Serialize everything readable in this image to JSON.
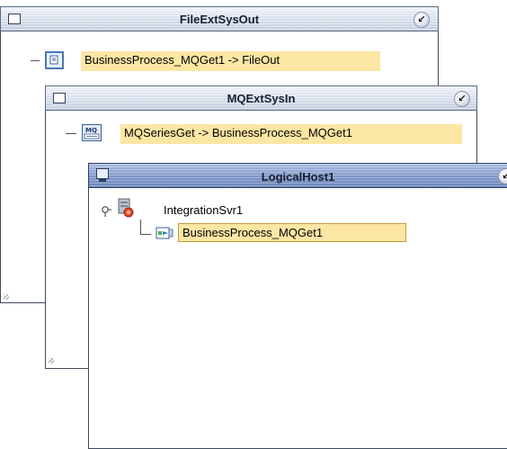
{
  "windows": [
    {
      "title": "FileExtSysOut",
      "rows": [
        {
          "label": "BusinessProcess_MQGet1 -> FileOut",
          "icon": "document-icon"
        }
      ]
    },
    {
      "title": "MQExtSysIn",
      "rows": [
        {
          "label": "MQSeriesGet -> BusinessProcess_MQGet1",
          "icon": "mq-series-icon"
        }
      ]
    },
    {
      "title": "LogicalHost1",
      "tree": {
        "server": {
          "label": "IntegrationSvr1",
          "icon": "integration-server-icon"
        },
        "child": {
          "label": "BusinessProcess_MQGet1",
          "icon": "business-process-icon"
        }
      }
    }
  ],
  "colors": {
    "highlight": "#fce6a4",
    "active_title": "#7f97c8",
    "inactive_title": "#d5dde9"
  }
}
